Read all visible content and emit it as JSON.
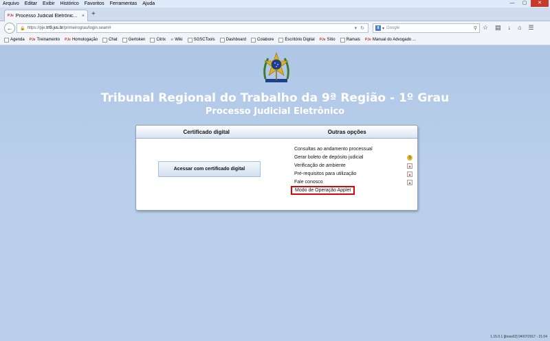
{
  "menu": [
    "Arquivo",
    "Editar",
    "Exibir",
    "Histórico",
    "Favoritos",
    "Ferramentas",
    "Ajuda"
  ],
  "window_controls": {
    "minimize": "—",
    "maximize": "▢",
    "close": "✕"
  },
  "tab": {
    "favicon": "PJe",
    "title": "Processo Judicial Eletrônic...",
    "close": "×",
    "new_tab": "+"
  },
  "nav": {
    "url_prefix": "https://pje.",
    "url_domain": "trt9.jus.br",
    "url_path": "/primeirograu/login.seam#",
    "search_engine": "8",
    "search_placeholder": "Google"
  },
  "bookmarks": [
    {
      "label": "Agenda",
      "icon": "page-icon"
    },
    {
      "label": "Treinamento",
      "icon": "pje-icon"
    },
    {
      "label": "Homologação",
      "icon": "pje-icon"
    },
    {
      "label": "Chat",
      "icon": "page-icon"
    },
    {
      "label": "Gertoken",
      "icon": "page-icon"
    },
    {
      "label": "Citrix",
      "icon": "page-icon"
    },
    {
      "label": "Wiki",
      "icon": "wiki-icon"
    },
    {
      "label": "SGSCTools",
      "icon": "page-icon"
    },
    {
      "label": "Dashboard",
      "icon": "page-icon"
    },
    {
      "label": "Colabore",
      "icon": "page-icon"
    },
    {
      "label": "Escritório Digital",
      "icon": "page-icon"
    },
    {
      "label": "Sítio",
      "icon": "pje-icon"
    },
    {
      "label": "Ramais",
      "icon": "page-icon"
    },
    {
      "label": "Manual do Advogado ...",
      "icon": "pje-icon"
    }
  ],
  "page": {
    "title": "Tribunal Regional do Trabalho da 9ª Região - 1º Grau",
    "subtitle": "Processo Judicial Eletrônico",
    "col_cert": "Certificado digital",
    "col_other": "Outras opções",
    "cert_button": "Acessar com certificado digital",
    "options": [
      {
        "label": "Consultas ao andamento processual",
        "icon": ""
      },
      {
        "label": "Gerar boleto de depósito judicial",
        "icon": "coin-icon"
      },
      {
        "label": "Verificação de ambiente",
        "icon": "pdf-icon"
      },
      {
        "label": "Pré-requisitos para utilização",
        "icon": "pdf-icon"
      },
      {
        "label": "Fale conosco",
        "icon": "pdf-icon"
      },
      {
        "label": "Modo de Operação Applet",
        "icon": "",
        "highlighted": true
      }
    ],
    "highlight_color": "#e00000"
  },
  "footer": "1.15.0.1 [jboss02] 04/07/2017 - 21:04"
}
